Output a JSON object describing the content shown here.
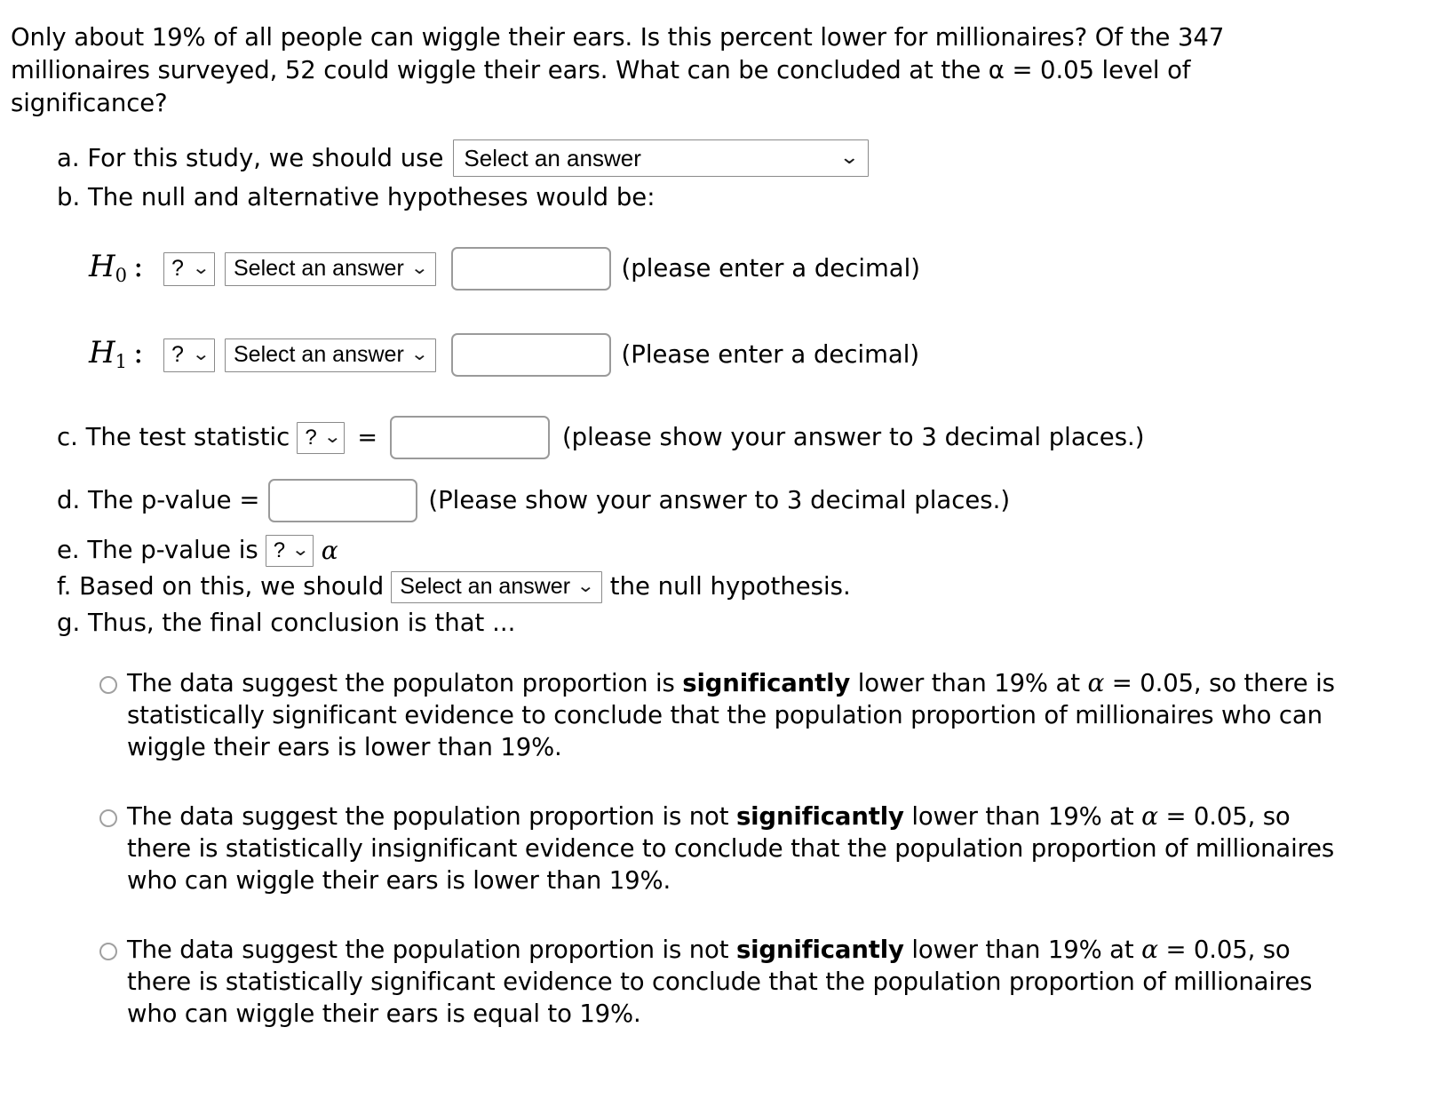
{
  "prompt": "Only about 19% of all people can wiggle their ears. Is this percent lower for millionaires? Of the 347 millionaires surveyed, 52 could wiggle their ears. What can be concluded at the α = 0.05 level of significance?",
  "select_placeholder": "Select an answer",
  "qmark_placeholder": "?",
  "chevron": "⌄",
  "alpha": "α",
  "sections": {
    "a": {
      "label": "a. For this study, we should use",
      "select_value": "Select an answer"
    },
    "b": {
      "label": "b. The null and alternative hypotheses would be:",
      "h0": {
        "symbol": "H",
        "subscript": "0",
        "colon": ":",
        "comparator_value": "?",
        "parameter_value": "Select an answer",
        "input_value": "",
        "hint": "(please enter a decimal)"
      },
      "h1": {
        "symbol": "H",
        "subscript": "1",
        "colon": ":",
        "comparator_value": "?",
        "parameter_value": "Select an answer",
        "input_value": "",
        "hint": "(Please enter a decimal)"
      }
    },
    "c": {
      "label": "c. The test statistic",
      "statistic_value": "?",
      "equals": "=",
      "input_value": "",
      "hint": "(please show your answer to 3 decimal places.)"
    },
    "d": {
      "label": "d. The p-value =",
      "input_value": "",
      "hint": "(Please show your answer to 3 decimal places.)"
    },
    "e": {
      "label": "e. The p-value is",
      "comparator_value": "?",
      "alpha": "α"
    },
    "f": {
      "label_before": "f. Based on this, we should",
      "select_value": "Select an answer",
      "label_after": "the null hypothesis."
    },
    "g": {
      "label": "g. Thus, the final conclusion is that ..."
    }
  },
  "options": [
    {
      "id": "option-1",
      "part1": "The data suggest the populaton proportion is ",
      "bold": "significantly",
      "part2": " lower than 19% at ",
      "alpha": "α",
      "part3": " = 0.05, so there is statistically significant evidence to conclude that the population proportion of millionaires who can wiggle their ears is lower than 19%.",
      "selected": false
    },
    {
      "id": "option-2",
      "part1": "The data suggest the population proportion is not ",
      "bold": "significantly",
      "part2": " lower than 19% at ",
      "alpha": "α",
      "part3": " = 0.05, so there is statistically insignificant evidence to conclude that the population proportion of millionaires who can wiggle their ears is lower than 19%.",
      "selected": false
    },
    {
      "id": "option-3",
      "part1": "The data suggest the population proportion is not ",
      "bold": "significantly",
      "part2": " lower than 19% at ",
      "alpha": "α",
      "part3": " = 0.05, so there is statistically significant evidence to conclude that the population proportion of millionaires who can wiggle their ears is equal to 19%.",
      "selected": false
    }
  ],
  "colors": {
    "background": "#ffffff",
    "text": "#000000",
    "border": "#8a8a8a",
    "input_border": "#9a9a9a",
    "radio_border": "#a0a0a0"
  }
}
